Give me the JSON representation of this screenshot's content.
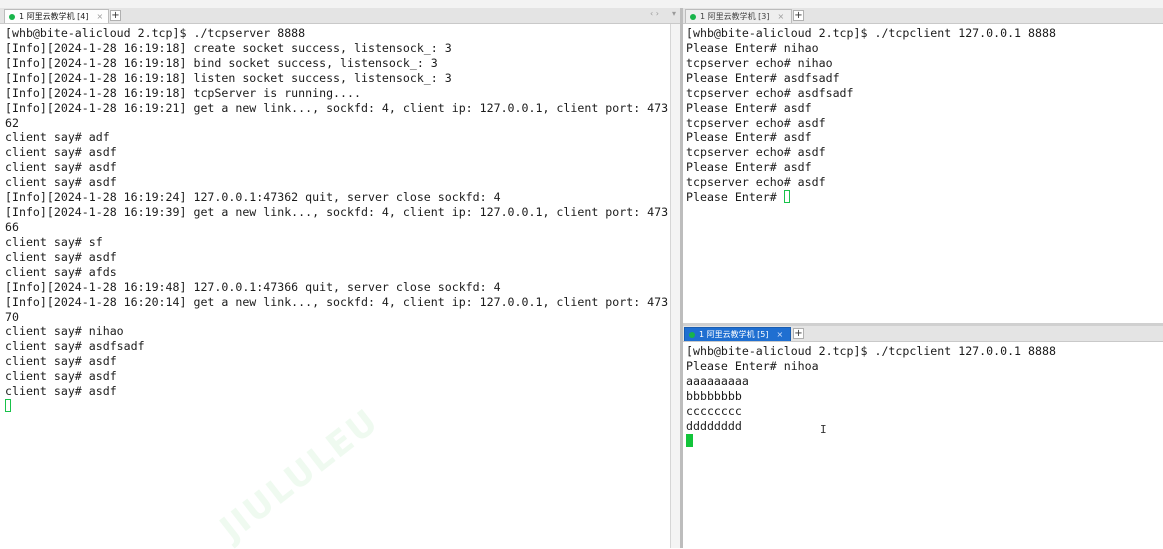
{
  "top_strip": {
    "faint_text": ""
  },
  "left_pane": {
    "tab_label": "1 阿里云教学机 [4]",
    "lines": [
      "[whb@bite-alicloud 2.tcp]$ ./tcpserver 8888",
      "[Info][2024-1-28 16:19:18] create socket success, listensock_: 3",
      "[Info][2024-1-28 16:19:18] bind socket success, listensock_: 3",
      "[Info][2024-1-28 16:19:18] listen socket success, listensock_: 3",
      "[Info][2024-1-28 16:19:18] tcpServer is running....",
      "[Info][2024-1-28 16:19:21] get a new link..., sockfd: 4, client ip: 127.0.0.1, client port: 473",
      "62",
      "client say# adf",
      "client say# asdf",
      "client say# asdf",
      "client say# asdf",
      "[Info][2024-1-28 16:19:24] 127.0.0.1:47362 quit, server close sockfd: 4",
      "[Info][2024-1-28 16:19:39] get a new link..., sockfd: 4, client ip: 127.0.0.1, client port: 473",
      "66",
      "client say# sf",
      "client say# asdf",
      "client say# afds",
      "[Info][2024-1-28 16:19:48] 127.0.0.1:47366 quit, server close sockfd: 4",
      "[Info][2024-1-28 16:20:14] get a new link..., sockfd: 4, client ip: 127.0.0.1, client port: 473",
      "70",
      "client say# nihao",
      "client say# asdfsadf",
      "client say# asdf",
      "client say# asdf",
      "client say# asdf"
    ]
  },
  "right_top_pane": {
    "tab_label": "1 阿里云教学机 [3]",
    "lines": [
      "[whb@bite-alicloud 2.tcp]$ ./tcpclient 127.0.0.1 8888",
      "Please Enter# nihao",
      "tcpserver echo# nihao",
      "Please Enter# asdfsadf",
      "tcpserver echo# asdfsadf",
      "Please Enter# asdf",
      "tcpserver echo# asdf",
      "Please Enter# asdf",
      "tcpserver echo# asdf",
      "Please Enter# asdf",
      "tcpserver echo# asdf",
      "Please Enter# "
    ]
  },
  "right_bottom_pane": {
    "tab_label": "1 阿里云教学机 [5]",
    "lines": [
      "[whb@bite-alicloud 2.tcp]$ ./tcpclient 127.0.0.1 8888",
      "Please Enter# nihoa",
      "aaaaaaaaa",
      "bbbbbbbb",
      "cccccccc",
      "dddddddd"
    ]
  },
  "icons": {
    "tab_status": "green-dot-icon",
    "tab_close": "close-icon",
    "new_tab": "plus-icon",
    "mouse": "i-beam-cursor-icon"
  },
  "colors": {
    "cursor": "#12c43a",
    "active_tab": "#1f6fd1",
    "status_dot": "#18b44a"
  }
}
